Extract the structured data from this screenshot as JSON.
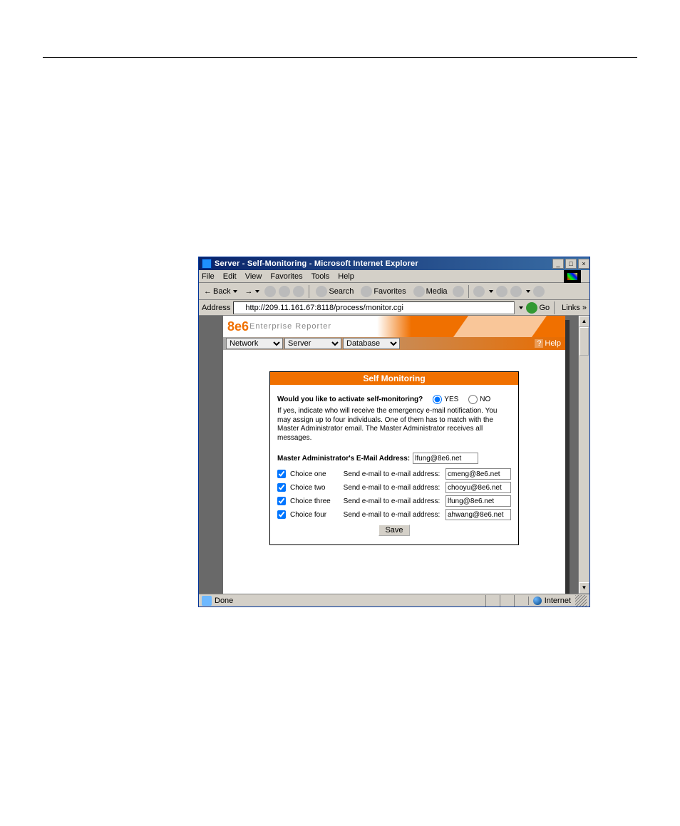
{
  "titlebar": {
    "title": "Server - Self-Monitoring - Microsoft Internet Explorer"
  },
  "win_btns": {
    "min": "_",
    "max": "□",
    "close": "×"
  },
  "menubar": {
    "items": [
      "File",
      "Edit",
      "View",
      "Favorites",
      "Tools",
      "Help"
    ]
  },
  "toolbar": {
    "back": "Back",
    "search": "Search",
    "favorites": "Favorites",
    "media": "Media"
  },
  "addressbar": {
    "label": "Address",
    "value": "http://209.11.161.67:8118/process/monitor.cgi",
    "go": "Go",
    "links": "Links"
  },
  "branding": {
    "logo": "8e6",
    "product": "Enterprise Reporter"
  },
  "nav_selects": {
    "network": "Network",
    "server": "Server",
    "database": "Database"
  },
  "help": {
    "label": "Help"
  },
  "panel": {
    "title": "Self Monitoring",
    "question": "Would you like to activate self-monitoring?",
    "yes": "YES",
    "no": "NO",
    "activate": "yes",
    "desc": "If yes, indicate who will receive the emergency e-mail notification. You may assign up to four individuals. One of them has to match with the Master Administrator email. The Master Administrator receives all messages.",
    "master_label": "Master Administrator's E-Mail Address:",
    "master_value": "lfung@8e6.net",
    "send_label": "Send e-mail to e-mail address:",
    "choices": [
      {
        "label": "Choice one",
        "checked": true,
        "value": "cmeng@8e6.net"
      },
      {
        "label": "Choice two",
        "checked": true,
        "value": "chooyu@8e6.net"
      },
      {
        "label": "Choice three",
        "checked": true,
        "value": "lfung@8e6.net"
      },
      {
        "label": "Choice four",
        "checked": true,
        "value": "ahwang@8e6.net"
      }
    ],
    "save": "Save"
  },
  "statusbar": {
    "done": "Done",
    "zone": "Internet"
  }
}
